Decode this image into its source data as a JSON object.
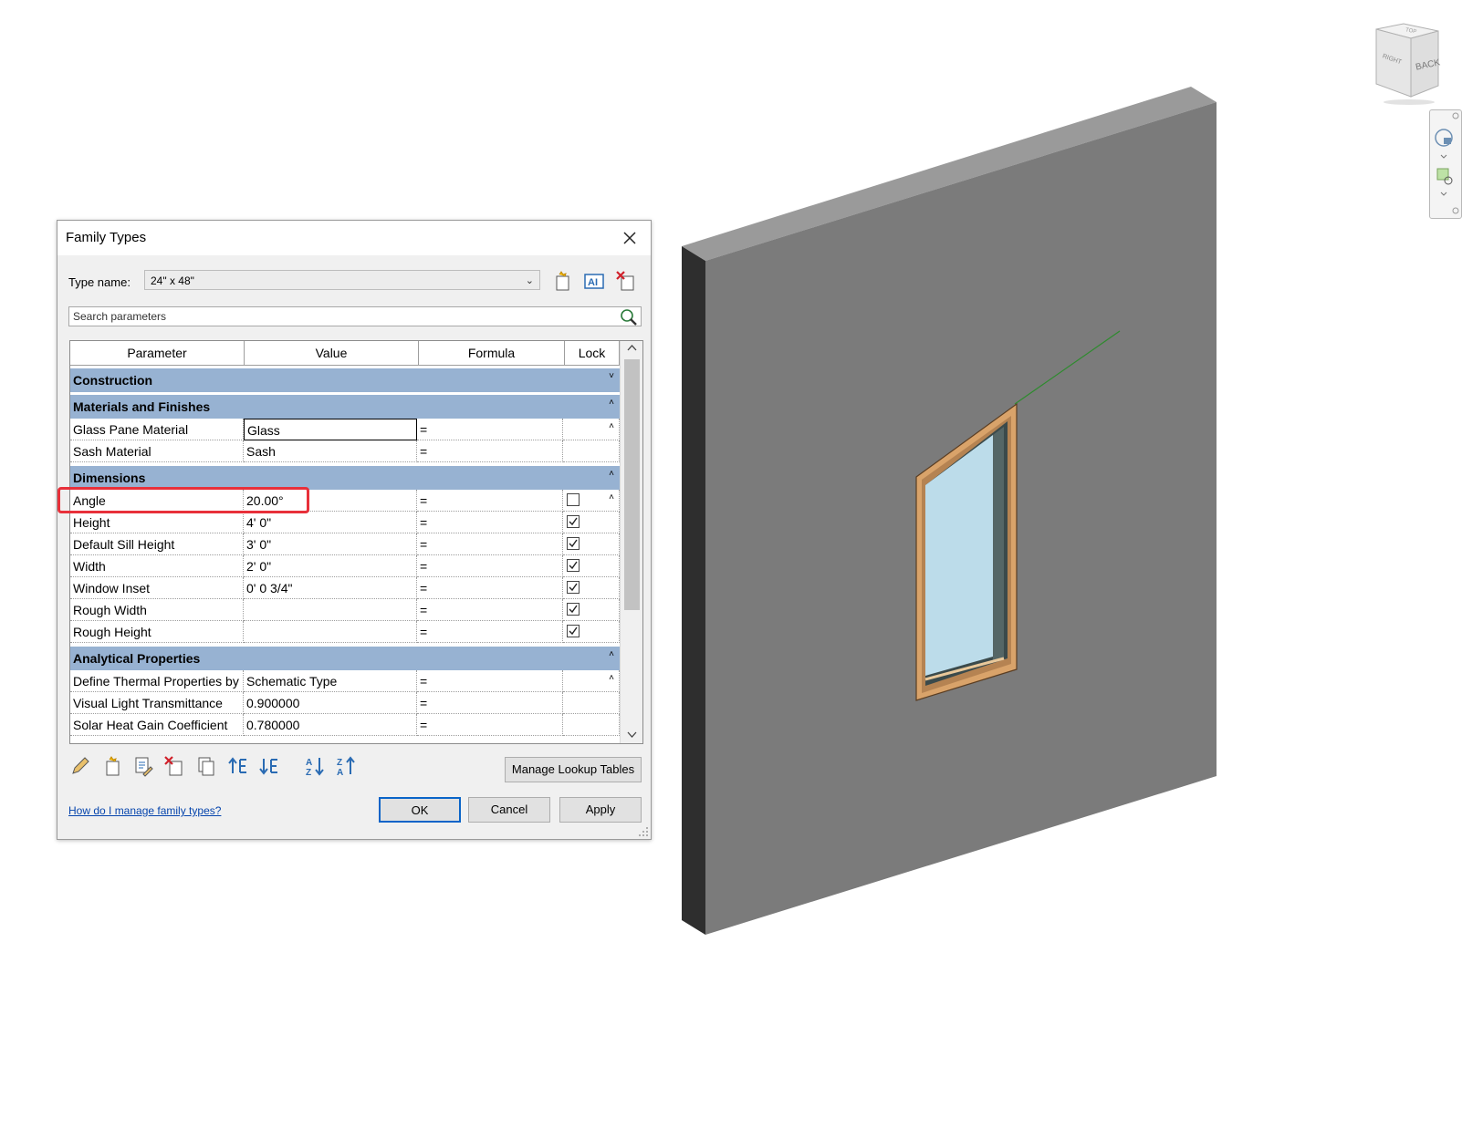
{
  "dialog": {
    "title": "Family Types",
    "type_name_label": "Type name:",
    "type_name_value": "24\" x 48\"",
    "search_placeholder": "Search parameters",
    "columns": [
      "Parameter",
      "Value",
      "Formula",
      "Lock"
    ],
    "groups": {
      "construction": "Construction",
      "materials": "Materials and Finishes",
      "dimensions": "Dimensions",
      "analytical": "Analytical Properties"
    },
    "rows": {
      "glass": {
        "param": "Glass Pane Material",
        "value": "Glass",
        "formula": "="
      },
      "sash": {
        "param": "Sash Material",
        "value": "Sash",
        "formula": "="
      },
      "angle": {
        "param": "Angle",
        "value": "20.00°",
        "formula": "=",
        "locked": false
      },
      "height": {
        "param": "Height",
        "value": "4'  0\"",
        "formula": "=",
        "locked": true
      },
      "sill": {
        "param": "Default Sill Height",
        "value": "3'  0\"",
        "formula": "=",
        "locked": true
      },
      "width": {
        "param": "Width",
        "value": "2'  0\"",
        "formula": "=",
        "locked": true
      },
      "inset": {
        "param": "Window Inset",
        "value": "0'  0 3/4\"",
        "formula": "=",
        "locked": true
      },
      "rough_width": {
        "param": "Rough Width",
        "value": "",
        "formula": "=",
        "locked": true
      },
      "rough_height": {
        "param": "Rough Height",
        "value": "",
        "formula": "=",
        "locked": true
      },
      "thermal": {
        "param": "Define Thermal Properties by",
        "value": "Schematic Type",
        "formula": "="
      },
      "vlt": {
        "param": "Visual Light Transmittance",
        "value": "0.900000",
        "formula": "="
      },
      "shgc": {
        "param": "Solar Heat Gain Coefficient",
        "value": "0.780000",
        "formula": "="
      }
    },
    "buttons": {
      "manage_lookup": "Manage Lookup Tables",
      "ok": "OK",
      "cancel": "Cancel",
      "apply": "Apply"
    },
    "help_link": "How do I manage family types?"
  },
  "viewcube": {
    "front_label": "BACK",
    "side_label": "RIGHT",
    "top_label": "TOP"
  },
  "colors": {
    "group_header": "#97b2d2",
    "highlight": "#e8303a",
    "wall_face": "#7b7b7b",
    "glass": "#bcdcea",
    "frame": "#d9a36a"
  }
}
